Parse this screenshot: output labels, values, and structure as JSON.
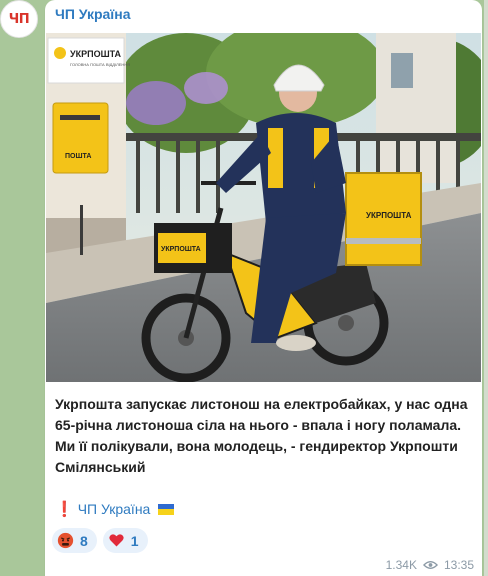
{
  "channel": {
    "avatar_text": "ЧП",
    "name": "ЧП Україна"
  },
  "photo": {
    "sign_text": "УКРПОШТА",
    "sign_subtext": "ГОЛОВНА ПОШТА ВІДДІЛЕННЯ",
    "mailbox_text": "ПОШТА",
    "bike_bag_text": "УКРПОШТА",
    "box_text": "УКРПОШТА",
    "brand_color": "#f3c318"
  },
  "post": {
    "text": "Укрпошта запускає листонош на електробайках, у нас одна 65-річна листоноша сіла на нього - впала і ногу поламала. Ми її полікували, вона молодець, - гендиректор Укрпошти Смілянський",
    "signature_mark": "❗",
    "signature_text": "ЧП Україна"
  },
  "reactions": [
    {
      "emoji": "angry-face",
      "count": "8"
    },
    {
      "emoji": "red-heart",
      "count": "1"
    }
  ],
  "meta": {
    "views": "1.34K",
    "time": "13:35"
  }
}
